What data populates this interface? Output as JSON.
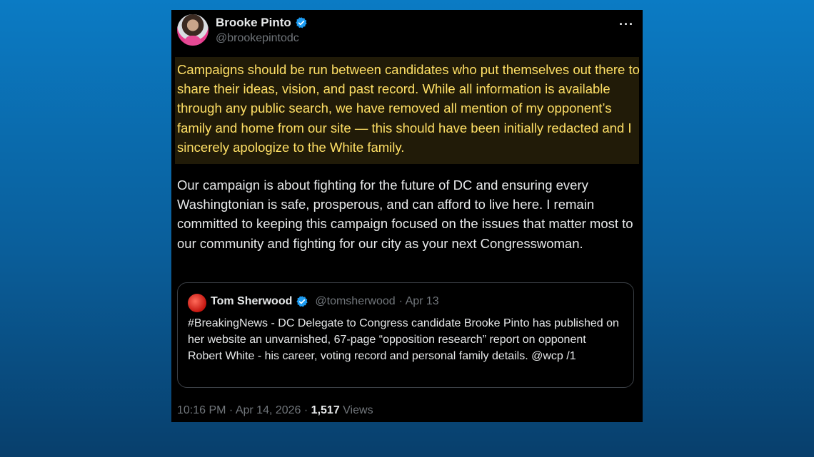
{
  "author": {
    "name": "Brooke Pinto",
    "handle": "@brookepintodc"
  },
  "menu": {
    "more_label": "···"
  },
  "tweet": {
    "highlighted_text": "Campaigns should be run between candidates who put themselves out there to share their ideas, vision, and past record. While all information is available through any public search, we have removed all mention of my opponent’s family and home from our site — this should have been initially redacted and I sincerely apologize to the White family.",
    "body_text": "Our campaign is about fighting for the future of DC and ensuring every Washingtonian is safe, prosperous, and can afford to live here. I remain committed to keeping this campaign focused on the issues that matter most to our community and fighting for our city as your next Congresswoman."
  },
  "quoted_tweet": {
    "name": "Tom Sherwood",
    "handle": "@tomsherwood",
    "date": "· Apr 13",
    "text": "#BreakingNews - DC Delegate to Congress candidate Brooke Pinto has published on her website an unvarnished, 67-page “opposition research” report on opponent Robert White - his career, voting record and personal family details. @wcp /1"
  },
  "footer": {
    "timestamp": "10:16 PM · Apr 14, 2026 ·",
    "views_count": "1,517",
    "views_label": "Views"
  },
  "colors": {
    "verified": "#1d9bf0",
    "highlight_text": "#ffe066",
    "background_top": "#0b7bc4",
    "background_bottom": "#083f6c"
  },
  "icons": [
    "verified-badge-icon",
    "more-options-icon"
  ]
}
